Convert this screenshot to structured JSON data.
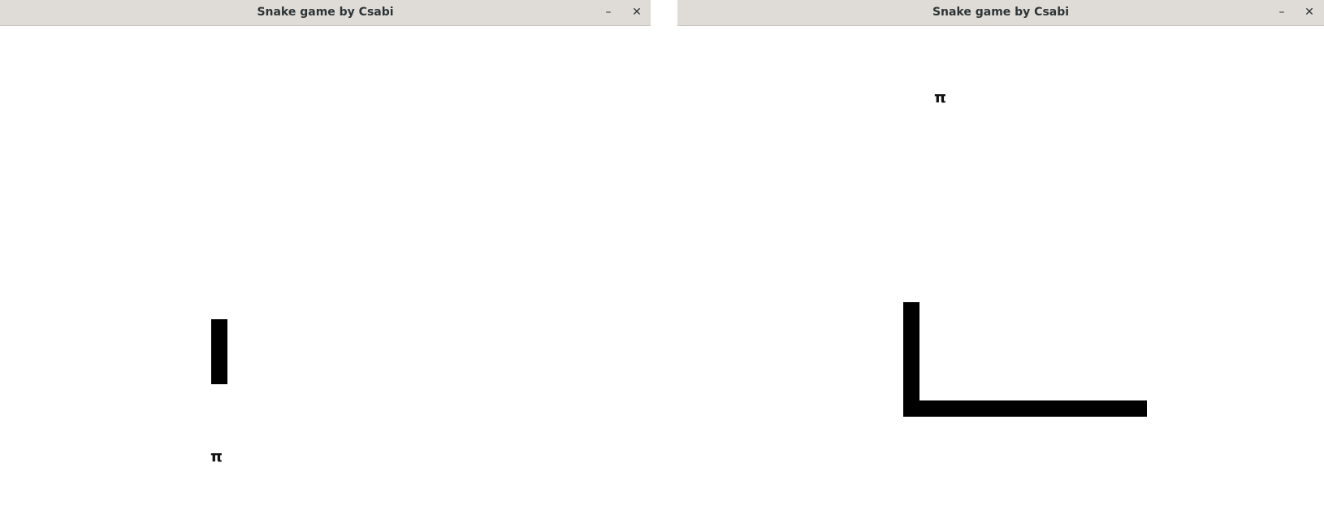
{
  "windows": [
    {
      "title": "Snake game by Csabi",
      "minimize_symbol": "–",
      "close_symbol": "✕",
      "food_symbol": "π"
    },
    {
      "title": "Snake game by Csabi",
      "minimize_symbol": "–",
      "close_symbol": "✕",
      "food_symbol": "π"
    }
  ],
  "colors": {
    "titlebar": "#dfdcd8",
    "background": "#ffffff",
    "snake": "#000000"
  }
}
